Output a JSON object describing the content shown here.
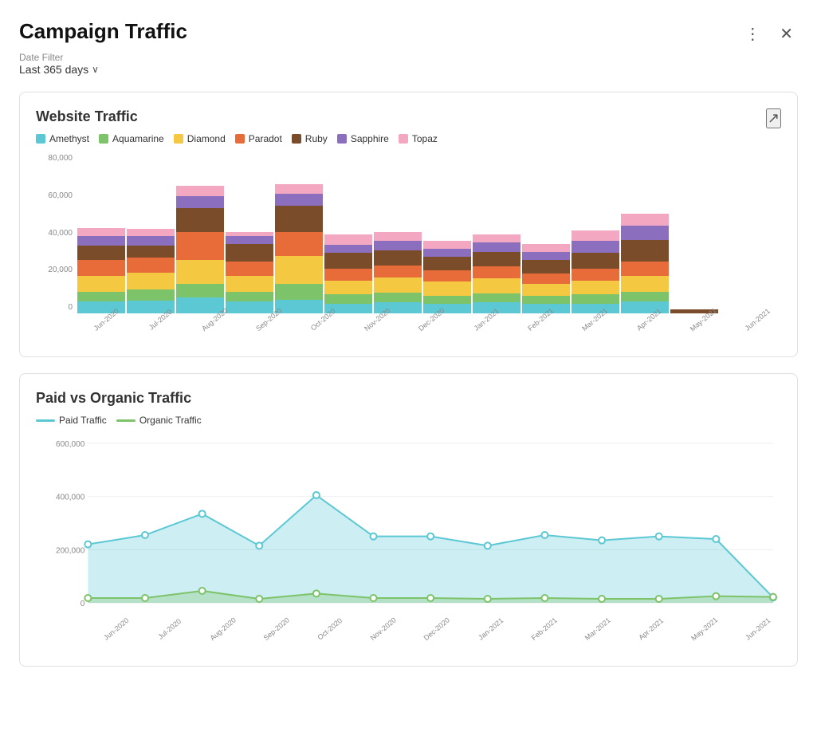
{
  "header": {
    "title": "Campaign Traffic",
    "more_icon": "⋮",
    "close_icon": "✕"
  },
  "date_filter": {
    "label": "Date Filter",
    "value": "Last 365 days",
    "chevron": "∨"
  },
  "website_traffic": {
    "title": "Website Traffic",
    "expand_icon": "↗",
    "legend": [
      {
        "label": "Amethyst",
        "color": "#5BC8D4"
      },
      {
        "label": "Aquamarine",
        "color": "#7DC36A"
      },
      {
        "label": "Diamond",
        "color": "#F5C842"
      },
      {
        "label": "Paradot",
        "color": "#E86C3A"
      },
      {
        "label": "Ruby",
        "color": "#7B4C2A"
      },
      {
        "label": "Sapphire",
        "color": "#8B6FBE"
      },
      {
        "label": "Topaz",
        "color": "#F4A7C0"
      }
    ],
    "y_labels": [
      "0",
      "20,000",
      "40,000",
      "60,000",
      "80,000"
    ],
    "months": [
      "Jun-2020",
      "Jul-2020",
      "Aug-2020",
      "Sep-2020",
      "Oct-2020",
      "Nov-2020",
      "Dec-2020",
      "Jan-2021",
      "Feb-2021",
      "Mar-2021",
      "Apr-2021",
      "May-2021",
      "Jun-2021"
    ],
    "bars": [
      [
        6000,
        5000,
        8000,
        8000,
        7000,
        5000,
        4000
      ],
      [
        6500,
        5500,
        8500,
        7500,
        6000,
        5000,
        3500
      ],
      [
        8000,
        7000,
        12000,
        14000,
        12000,
        6000,
        5000
      ],
      [
        6000,
        5000,
        8000,
        7000,
        9000,
        4000,
        2000
      ],
      [
        7000,
        8000,
        14000,
        12000,
        13000,
        6000,
        5000
      ],
      [
        5000,
        4500,
        7000,
        6000,
        8000,
        4000,
        5000
      ],
      [
        5500,
        5000,
        7500,
        6000,
        7500,
        5000,
        4500
      ],
      [
        5000,
        4000,
        7000,
        5500,
        7000,
        4000,
        4000
      ],
      [
        5500,
        4500,
        7500,
        6000,
        7500,
        4500,
        4000
      ],
      [
        5000,
        4000,
        6000,
        5000,
        7000,
        4000,
        4000
      ],
      [
        5000,
        4500,
        7000,
        6000,
        8000,
        6000,
        5000
      ],
      [
        6000,
        5000,
        8000,
        7000,
        11000,
        7000,
        6000
      ],
      [
        0,
        0,
        0,
        0,
        2000,
        0,
        0
      ]
    ]
  },
  "paid_organic": {
    "title": "Paid vs Organic Traffic",
    "legend": [
      {
        "label": "Paid Traffic",
        "color": "#5BC8D4"
      },
      {
        "label": "Organic Traffic",
        "color": "#7DC36A"
      }
    ],
    "y_labels": [
      "0",
      "200,000",
      "400,000",
      "600,000"
    ],
    "months": [
      "Jun-2020",
      "Jul-2020",
      "Aug-2020",
      "Sep-2020",
      "Oct-2020",
      "Nov-2020",
      "Dec-2020",
      "Jan-2021",
      "Feb-2021",
      "Mar-2021",
      "Apr-2021",
      "May-2021",
      "Jun-2021"
    ],
    "paid_values": [
      220000,
      255000,
      335000,
      215000,
      405000,
      250000,
      250000,
      215000,
      255000,
      235000,
      250000,
      240000,
      20000
    ],
    "organic_values": [
      18000,
      18000,
      45000,
      15000,
      35000,
      18000,
      18000,
      15000,
      18000,
      15000,
      15000,
      25000,
      22000
    ]
  }
}
